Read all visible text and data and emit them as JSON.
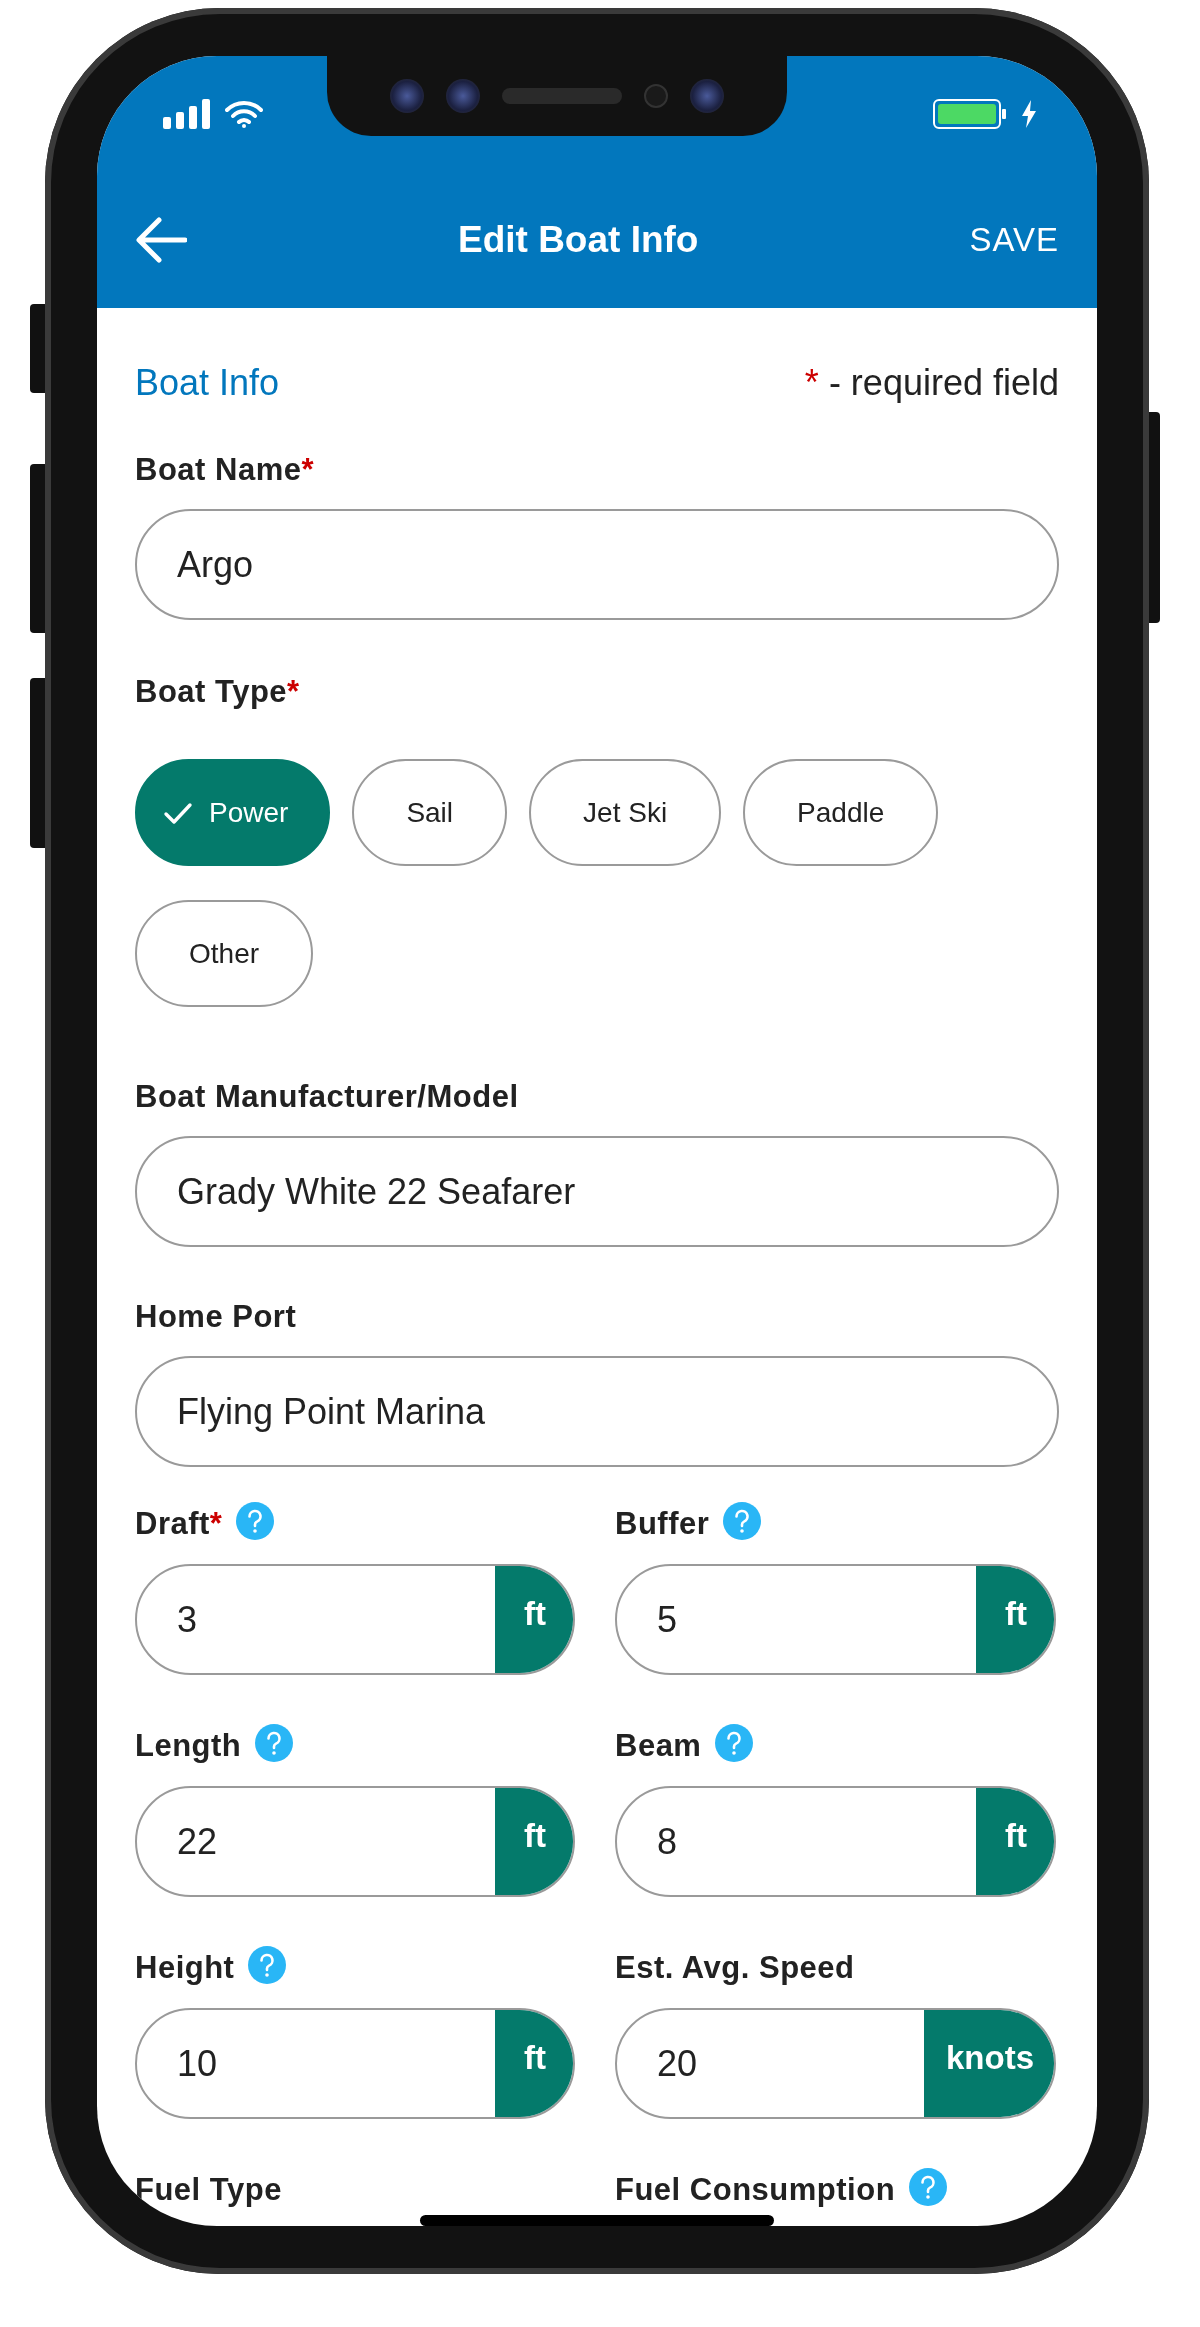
{
  "app_bar": {
    "title": "Edit Boat Info",
    "action": "SAVE"
  },
  "section": {
    "title": "Boat Info",
    "required_mark": "*",
    "required_note": "- required field"
  },
  "name_field": {
    "label": "Boat Name",
    "required_mark": "*",
    "value": "Argo"
  },
  "boat_type": {
    "label": "Boat Type",
    "required_mark": "*",
    "options": [
      {
        "label": "Power",
        "selected": true
      },
      {
        "label": "Sail",
        "selected": false
      },
      {
        "label": "Jet Ski",
        "selected": false
      },
      {
        "label": "Paddle",
        "selected": false
      },
      {
        "label": "Other",
        "selected": false
      }
    ]
  },
  "text_fields": [
    {
      "label": "Boat Manufacturer/Model",
      "value": "Grady White 22 Seafarer"
    },
    {
      "label": "Home Port",
      "value": "Flying Point Marina"
    }
  ],
  "measure_fields": [
    {
      "label": "Draft",
      "required_mark": "*",
      "help": true,
      "value": "3",
      "unit": "ft"
    },
    {
      "label": "Buffer",
      "help": true,
      "value": "5",
      "unit": "ft"
    },
    {
      "label": "Length",
      "help": true,
      "value": "22",
      "unit": "ft"
    },
    {
      "label": "Beam",
      "help": true,
      "value": "8",
      "unit": "ft"
    },
    {
      "label": "Height",
      "help": true,
      "value": "10",
      "unit": "ft"
    },
    {
      "label": "Est. Avg. Speed",
      "help": false,
      "value": "20",
      "unit": "knots"
    },
    {
      "label": "Fuel Type",
      "help": false
    },
    {
      "label": "Fuel Consumption",
      "help": true
    }
  ]
}
